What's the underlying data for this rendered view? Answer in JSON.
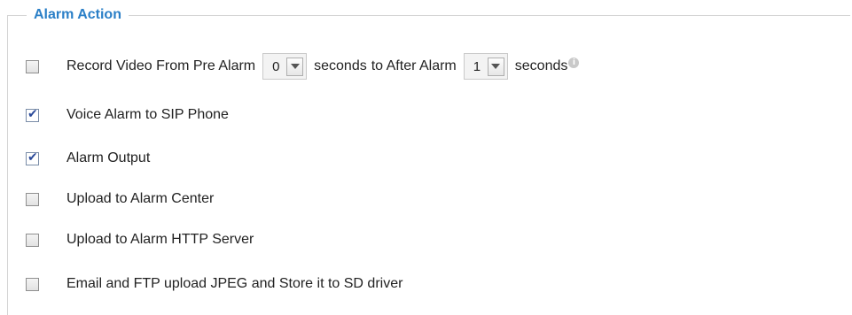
{
  "section": {
    "title": "Alarm Action"
  },
  "options": [
    {
      "label": "Record Video From Pre Alarm",
      "checked": false
    },
    {
      "label": "Voice Alarm to SIP Phone",
      "checked": true
    },
    {
      "label": "Alarm Output",
      "checked": true
    },
    {
      "label": "Upload to Alarm Center",
      "checked": false
    },
    {
      "label": "Upload to Alarm HTTP Server",
      "checked": false
    },
    {
      "label": "Email and FTP upload JPEG and Store it to SD driver",
      "checked": false
    }
  ],
  "record": {
    "pre_value": "0",
    "seconds_label_1": "seconds",
    "to_label": "to After Alarm",
    "after_value": "1",
    "seconds_label_2": "seconds",
    "info_glyph": "i"
  },
  "icons": {
    "info": "info-icon",
    "dropdown": "chevron-down-icon",
    "check": "checkmark-icon"
  },
  "colors": {
    "legend": "#2a7fc7",
    "check": "#2b4a9a"
  }
}
